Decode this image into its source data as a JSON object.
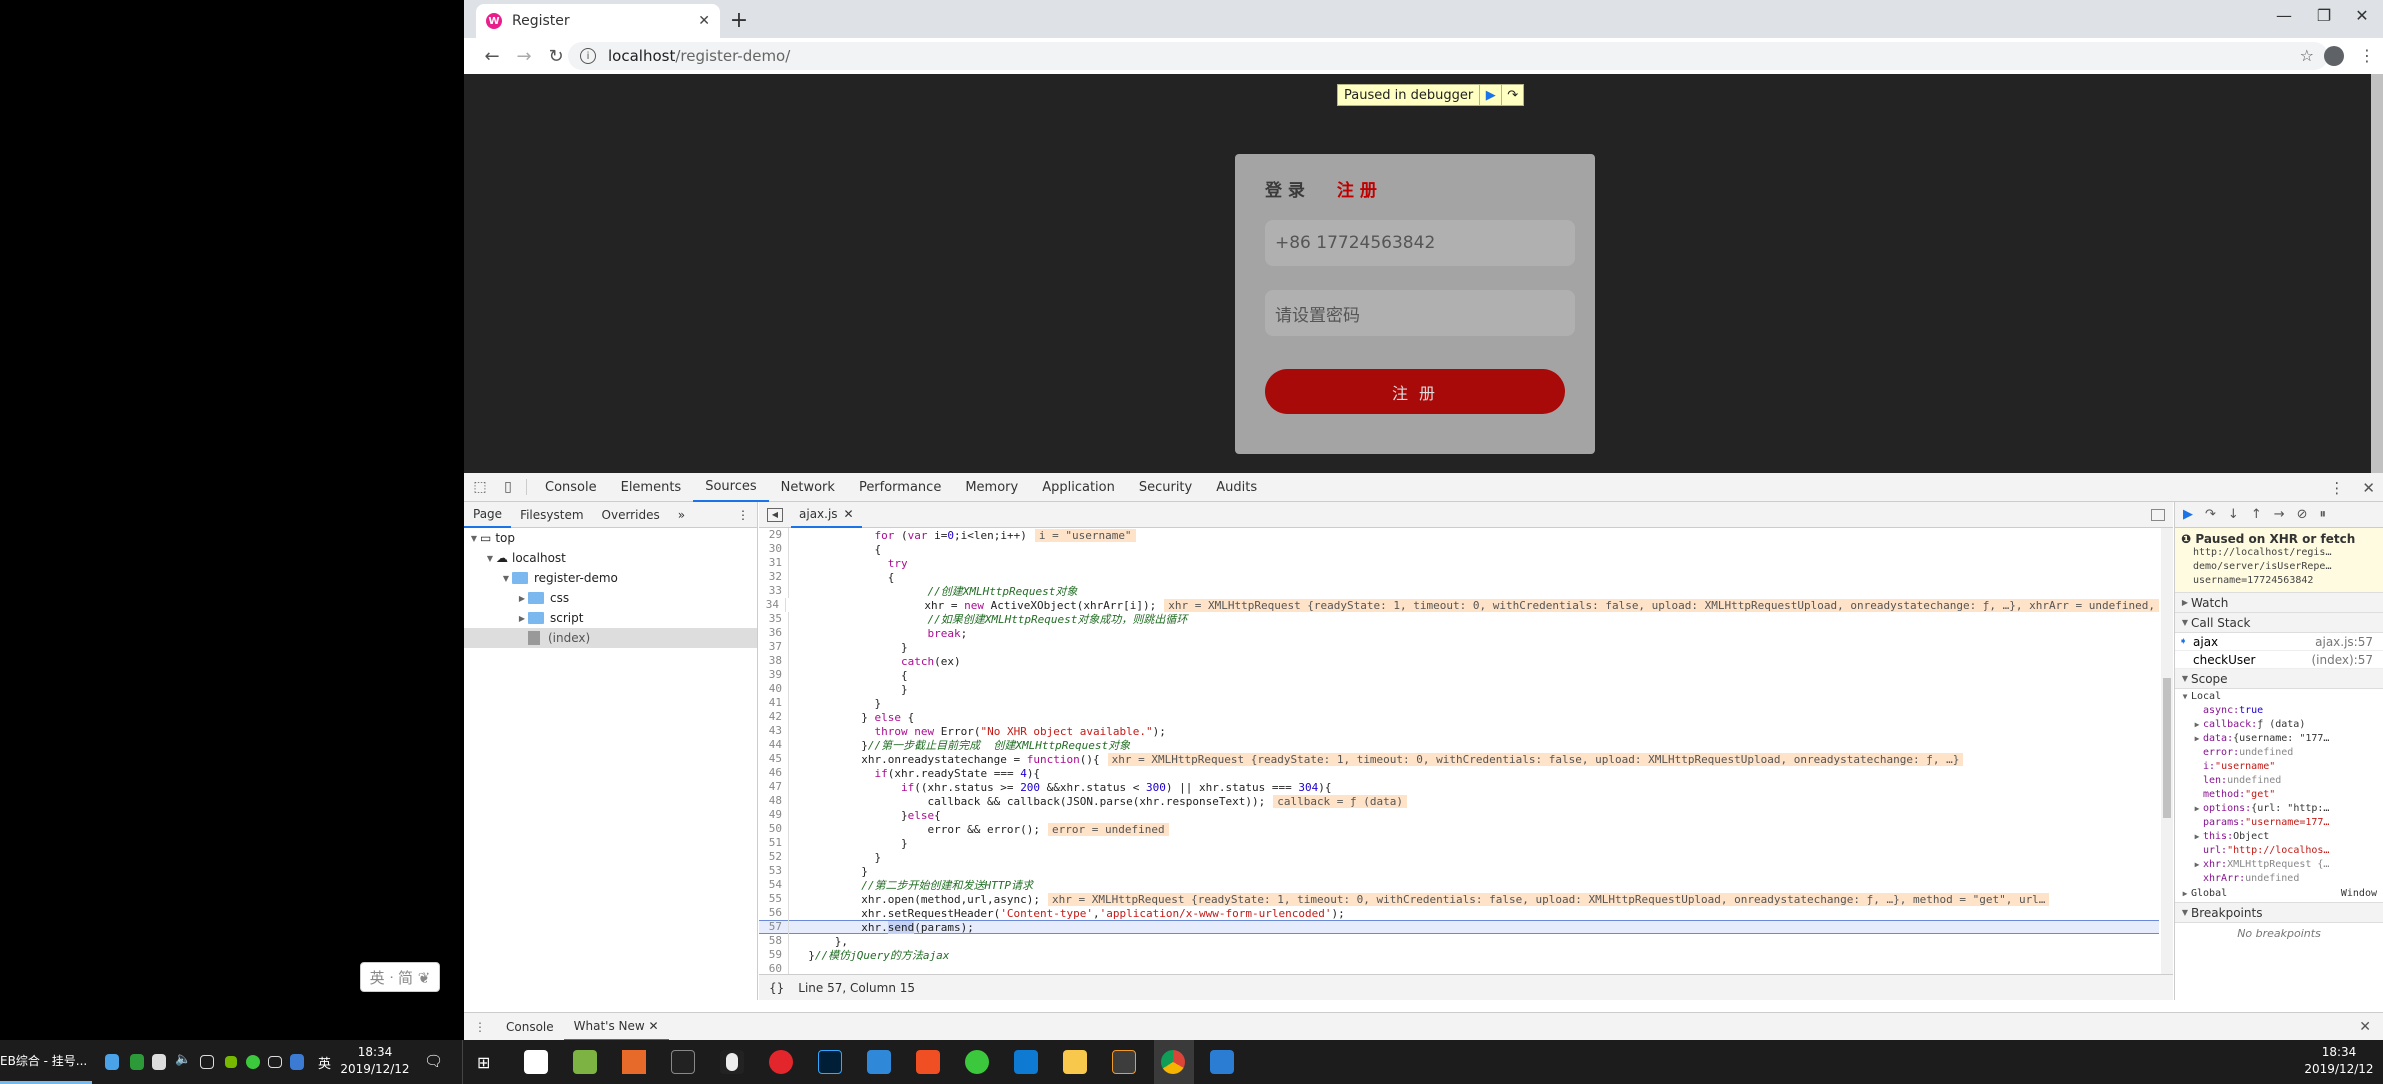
{
  "browser": {
    "tab_title": "Register",
    "tab_favicon": "wampserver-icon",
    "new_tab_icon": "+",
    "url_host": "localhost",
    "url_path": "/register-demo/",
    "window_controls": {
      "minimize": "—",
      "restore": "❐",
      "close": "✕"
    }
  },
  "page": {
    "debugger_banner": "Paused in debugger",
    "tabs": {
      "login": "登 录",
      "register": "注 册"
    },
    "phone_value": "+86  17724563842",
    "password_placeholder": "请设置密码",
    "submit_label": "注 册",
    "colors": {
      "accent": "#a80909",
      "active_tab": "#c00000"
    }
  },
  "devtools": {
    "tabs": [
      "Console",
      "Elements",
      "Sources",
      "Network",
      "Performance",
      "Memory",
      "Application",
      "Security",
      "Audits"
    ],
    "active_tab": "Sources",
    "navigator": {
      "tabs": [
        "Page",
        "Filesystem",
        "Overrides",
        "»"
      ],
      "tree": [
        {
          "label": "top",
          "indent": 0,
          "type": "frame",
          "expanded": true
        },
        {
          "label": "localhost",
          "indent": 1,
          "type": "cloud",
          "expanded": true
        },
        {
          "label": "register-demo",
          "indent": 2,
          "type": "folder",
          "expanded": true
        },
        {
          "label": "css",
          "indent": 3,
          "type": "folder",
          "expanded": false
        },
        {
          "label": "script",
          "indent": 3,
          "type": "folder",
          "expanded": false
        },
        {
          "label": "(index)",
          "indent": 3,
          "type": "file",
          "selected": true
        }
      ]
    },
    "editor": {
      "file_tab": "ajax.js",
      "current_line": 57,
      "status": "Line 57, Column 15",
      "lines": [
        {
          "n": 29,
          "html": "            <span class='kw'>for</span> (<span class='kw'>var</span> i=<span class='num'>0</span>;i&lt;len;i++)",
          "inline": "i = \"username\""
        },
        {
          "n": 30,
          "html": "            {"
        },
        {
          "n": 31,
          "html": "              <span class='kw'>try</span>"
        },
        {
          "n": 32,
          "html": "              {"
        },
        {
          "n": 33,
          "html": "                    <span class='cm'>//创建XMLHttpRequest对象</span>"
        },
        {
          "n": 34,
          "html": "                    xhr = <span class='kw'>new</span> ActiveXObject(xhrArr[i]);",
          "inline": "xhr = XMLHttpRequest {readyState: 1, timeout: 0, withCredentials: false, upload: XMLHttpRequestUpload, onreadystatechange: ƒ, …}, xhrArr = undefined,"
        },
        {
          "n": 35,
          "html": "                    <span class='cm'>//如果创建XMLHttpRequest对象成功，则跳出循环</span>"
        },
        {
          "n": 36,
          "html": "                    <span class='kw'>break</span>;"
        },
        {
          "n": 37,
          "html": "                }"
        },
        {
          "n": 38,
          "html": "                <span class='kw'>catch</span>(ex)"
        },
        {
          "n": 39,
          "html": "                {"
        },
        {
          "n": 40,
          "html": "                }"
        },
        {
          "n": 41,
          "html": "            }"
        },
        {
          "n": 42,
          "html": "          } <span class='kw'>else</span> {"
        },
        {
          "n": 43,
          "html": "            <span class='kw'>throw new</span> Error(<span class='str'>\"No XHR object available.\"</span>);"
        },
        {
          "n": 44,
          "html": "          }<span class='cm'>//第一步截止目前完成  创建XMLHttpRequest对象</span>"
        },
        {
          "n": 45,
          "html": "          xhr.onreadystatechange = <span class='kw'>function</span>(){",
          "inline": "xhr = XMLHttpRequest {readyState: 1, timeout: 0, withCredentials: false, upload: XMLHttpRequestUpload, onreadystatechange: ƒ, …}"
        },
        {
          "n": 46,
          "html": "            <span class='kw'>if</span>(xhr.readyState === <span class='num'>4</span>){"
        },
        {
          "n": 47,
          "html": "                <span class='kw'>if</span>((xhr.status &gt;= <span class='num'>200</span> &amp;&amp;xhr.status &lt; <span class='num'>300</span>) || xhr.status === <span class='num'>304</span>){"
        },
        {
          "n": 48,
          "html": "                    callback &amp;&amp; callback(JSON.parse(xhr.responseText));",
          "inline": "callback = ƒ (data)"
        },
        {
          "n": 49,
          "html": "                }<span class='kw'>else</span>{"
        },
        {
          "n": 50,
          "html": "                    error &amp;&amp; error();",
          "inline": "error = undefined"
        },
        {
          "n": 51,
          "html": "                }"
        },
        {
          "n": 52,
          "html": "            }"
        },
        {
          "n": 53,
          "html": "          }"
        },
        {
          "n": 54,
          "html": "          <span class='cm'>//第二步开始创建和发送HTTP请求</span>"
        },
        {
          "n": 55,
          "html": "          xhr.open(method,url,async);",
          "inline": "xhr = XMLHttpRequest {readyState: 1, timeout: 0, withCredentials: false, upload: XMLHttpRequestUpload, onreadystatechange: ƒ, …}, method = \"get\", url…"
        },
        {
          "n": 56,
          "html": "          xhr.setRequestHeader(<span class='str'>'Content-type'</span>,<span class='str'>'application/x-www-form-urlencoded'</span>);"
        },
        {
          "n": 57,
          "html": "          xhr.<span style='background:#c6d2f3'>send</span>(params);"
        },
        {
          "n": 58,
          "html": "      },"
        },
        {
          "n": 59,
          "html": "  }<span class='cm'>//模仿jQuery的方法ajax</span>"
        },
        {
          "n": 60,
          "html": ""
        }
      ]
    },
    "sidebar": {
      "paused_title": "Paused on XHR or fetch",
      "paused_url": [
        "http://localhost/regis…",
        "demo/server/isUserRepe…",
        "username=17724563842"
      ],
      "watch_label": "Watch",
      "call_stack_label": "Call Stack",
      "call_stack": [
        {
          "fn": "ajax",
          "loc": "ajax.js:57",
          "current": true
        },
        {
          "fn": "checkUser",
          "loc": "(index):57",
          "current": false
        }
      ],
      "scope_label": "Scope",
      "local_label": "Local",
      "scope_vars": [
        {
          "k": "async",
          "v": "true",
          "t": "sv",
          "exp": false
        },
        {
          "k": "callback",
          "v": "ƒ (data)",
          "t": "sm",
          "exp": true
        },
        {
          "k": "data",
          "v": "{username: \"177…",
          "t": "sm",
          "exp": true
        },
        {
          "k": "error",
          "v": "undefined",
          "t": "su",
          "exp": false
        },
        {
          "k": "i",
          "v": "\"username\"",
          "t": "ss",
          "exp": false
        },
        {
          "k": "len",
          "v": "undefined",
          "t": "su",
          "exp": false
        },
        {
          "k": "method",
          "v": "\"get\"",
          "t": "ss",
          "exp": false
        },
        {
          "k": "options",
          "v": "{url: \"http:…",
          "t": "sm",
          "exp": true
        },
        {
          "k": "params",
          "v": "\"username=177…",
          "t": "ss",
          "exp": false
        },
        {
          "k": "this",
          "v": "Object",
          "t": "sm",
          "exp": true
        },
        {
          "k": "url",
          "v": "\"http://localhos…",
          "t": "ss",
          "exp": false
        },
        {
          "k": "xhr",
          "v": "XMLHttpRequest {…",
          "t": "su",
          "exp": true
        },
        {
          "k": "xhrArr",
          "v": "undefined",
          "t": "su",
          "exp": false
        }
      ],
      "global_label": "Global",
      "global_value": "Window",
      "breakpoints_label": "Breakpoints",
      "no_breakpoints": "No breakpoints"
    },
    "drawer": {
      "tabs": [
        "Console",
        "What's New"
      ],
      "active": "What's New"
    }
  },
  "desktop": {
    "ime_text": "英 ᐧ 简 ❦",
    "left_task_label": "EB综合 - 挂号...",
    "left_clock_time": "18:34",
    "left_clock_date": "2019/12/12",
    "tray_lang": "英",
    "clock_time": "18:34",
    "clock_date": "2019/12/12"
  }
}
